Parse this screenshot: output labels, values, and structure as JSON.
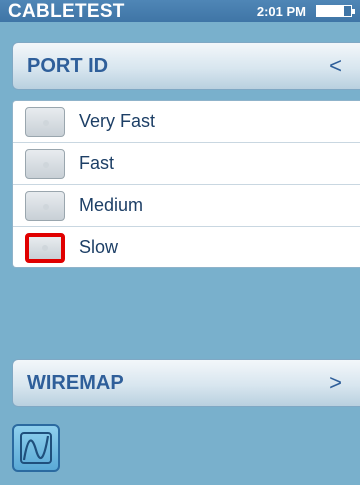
{
  "status_bar": {
    "app_title": "CABLETEST",
    "time": "2:01 PM",
    "battery_icon": "battery-icon"
  },
  "port_id_section": {
    "label": "PORT ID",
    "chevron": "<",
    "options": [
      {
        "label": "Very Fast",
        "checked": false
      },
      {
        "label": "Fast",
        "checked": false
      },
      {
        "label": "Medium",
        "checked": false
      },
      {
        "label": "Slow",
        "checked": false,
        "focused": true
      }
    ]
  },
  "wiremap_section": {
    "label": "WIREMAP",
    "chevron": ">"
  },
  "bottom_toolbar": {
    "graph_icon": "graph-icon"
  },
  "colors": {
    "background": "#79b0cc",
    "status_bar": "#3f75a6",
    "header_text": "#2f5f9a",
    "focus_outline": "#e00000"
  }
}
